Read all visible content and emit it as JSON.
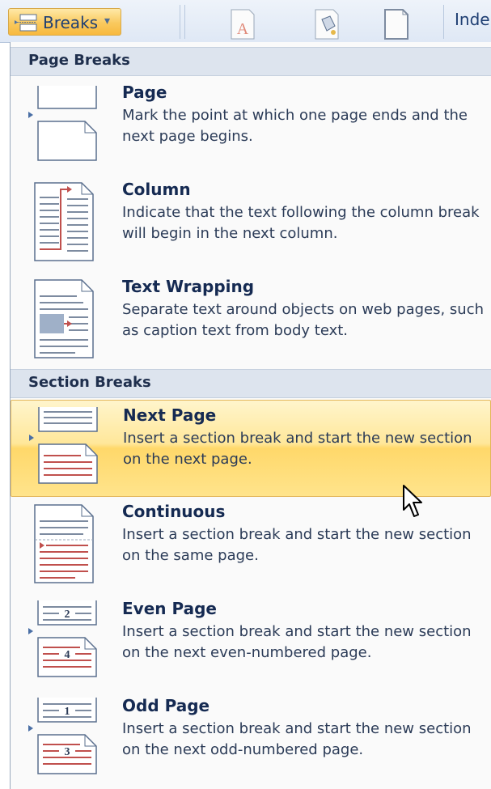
{
  "ribbon": {
    "breaks_label": "Breaks",
    "dropdown_arrow": "▾",
    "indent_label": "Inde",
    "icons": [
      "watermark-icon",
      "page-color-icon",
      "page-borders-icon"
    ]
  },
  "menu": {
    "sections": [
      {
        "header": "Page Breaks",
        "items": [
          {
            "title": "Page",
            "desc": "Mark the point at which one page ends and the next page begins.",
            "icon": "page-break-icon"
          },
          {
            "title": "Column",
            "desc": "Indicate that the text following the column break will begin in the next column.",
            "icon": "column-break-icon"
          },
          {
            "title": "Text Wrapping",
            "desc": "Separate text around objects on web pages, such as caption text from body text.",
            "icon": "text-wrapping-icon"
          }
        ]
      },
      {
        "header": "Section Breaks",
        "items": [
          {
            "title": "Next Page",
            "desc": "Insert a section break and start the new section on the next page.",
            "icon": "next-page-icon",
            "highlighted": true
          },
          {
            "title": "Continuous",
            "desc": "Insert a section break and start the new section on the same page.",
            "icon": "continuous-icon"
          },
          {
            "title": "Even Page",
            "desc": "Insert a section break and start the new section on the next even-numbered page.",
            "icon": "even-page-icon",
            "page_numbers": [
              "2",
              "4"
            ]
          },
          {
            "title": "Odd Page",
            "desc": "Insert a section break and start the new section on the next odd-numbered page.",
            "icon": "odd-page-icon",
            "page_numbers": [
              "1",
              "3"
            ]
          }
        ]
      }
    ]
  },
  "colors": {
    "highlight": "#ffe08a",
    "header_bg": "#dde4ee",
    "title_text": "#152a52",
    "break_marker": "#c0504d"
  }
}
